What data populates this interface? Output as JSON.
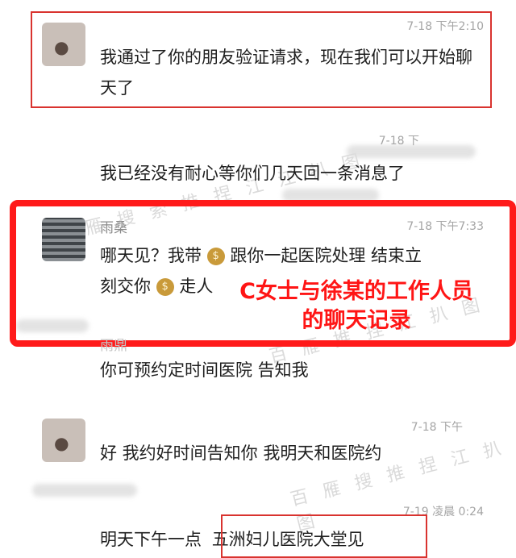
{
  "messages": [
    {
      "name": "",
      "time": "7-18 下午2:10",
      "text": "我通过了你的朋友验证请求，现在我们可以开始聊天了"
    },
    {
      "name": "",
      "time": "7-18 下",
      "text": "我已经没有耐心等你们几天回一条消息了"
    },
    {
      "name": "雨桑",
      "time": "7-18 下午7:33",
      "text_line1_a": "哪天见？我带",
      "text_line1_b": "跟你一起医院处理 结束立",
      "text_line2_a": "刻交你",
      "text_line2_b": "走人"
    },
    {
      "name": "雨鼎",
      "time": "",
      "text": "你可预约定时间医院 告知我"
    },
    {
      "name": "",
      "time": "7-18 下午",
      "text": "好 我约好时间告知你 我明天和医院约"
    },
    {
      "name": "",
      "time": "7-19 凌晨 0:24",
      "text_a": "明天下午一点",
      "text_b": "五洲妇儿医院大堂见"
    }
  ],
  "caption": {
    "line1": "C女士与徐某的工作人员",
    "line2": "的聊天记录"
  },
  "watermarks": [
    "百 雁 搜 索 推 捏 江 江 扒 图",
    "百 雁 推 捏 江 扒 图",
    "百 雁 搜 推 捏 江 扒 图"
  ],
  "money_glyph": "$"
}
